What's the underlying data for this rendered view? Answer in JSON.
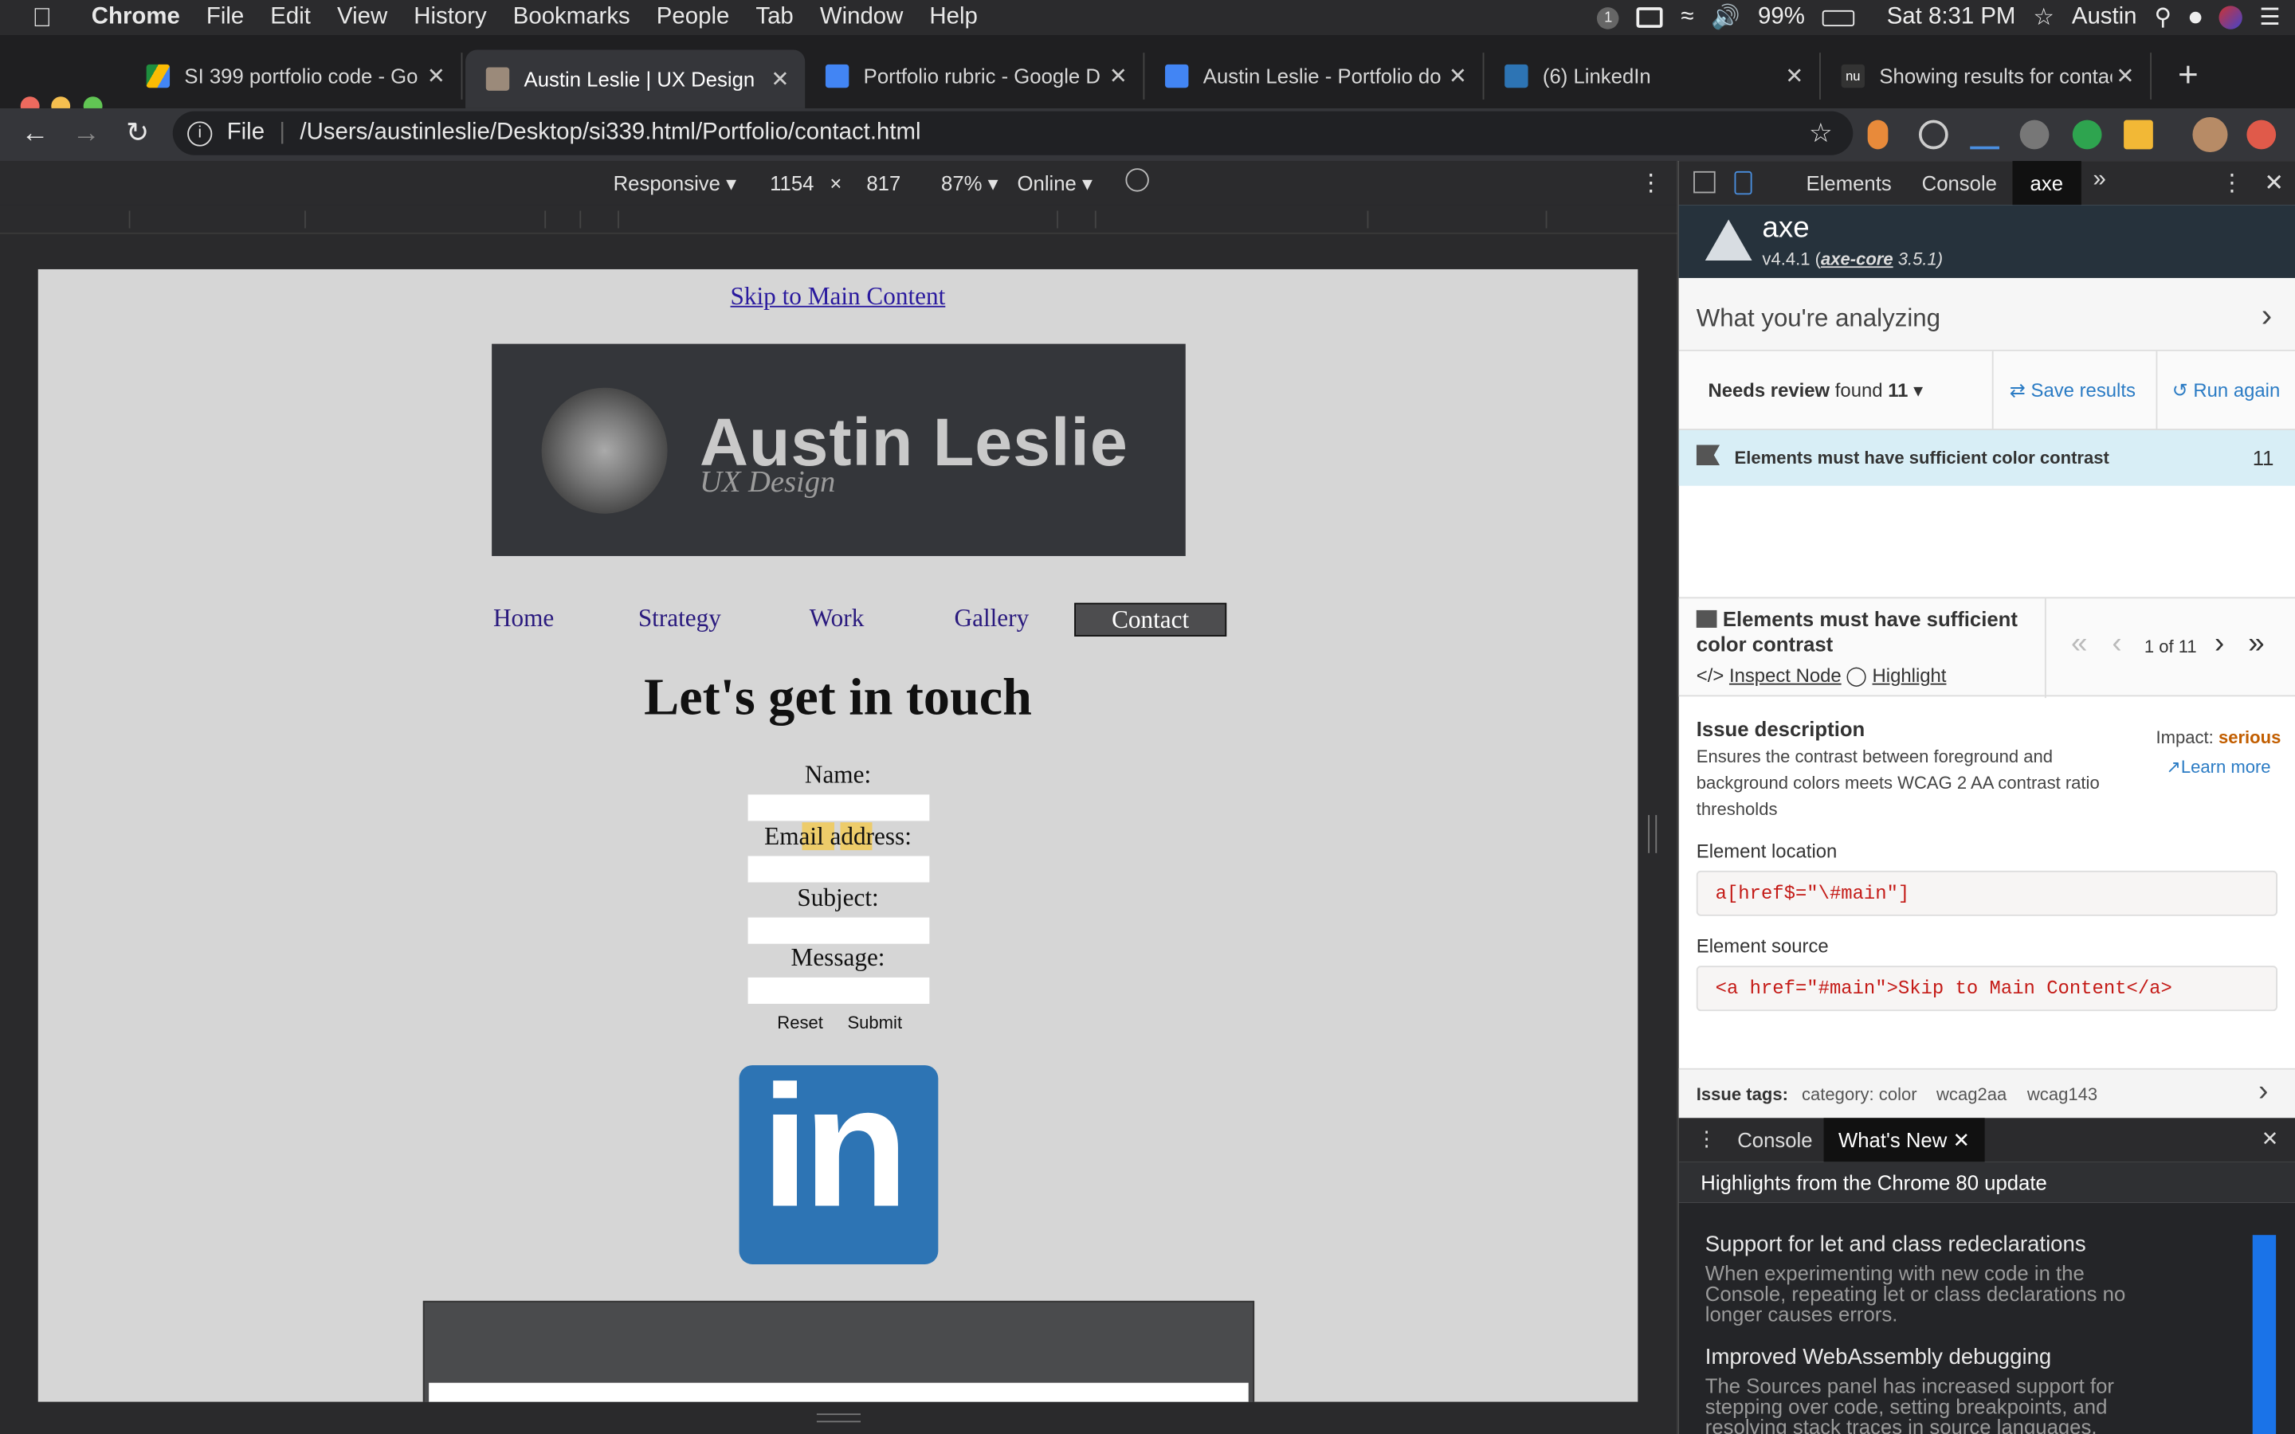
{
  "menubar": {
    "app": "Chrome",
    "items": [
      "File",
      "Edit",
      "View",
      "History",
      "Bookmarks",
      "People",
      "Tab",
      "Window",
      "Help"
    ],
    "battery": "99%",
    "clock": "Sat 8:31 PM",
    "user": "Austin",
    "notif_count": "1"
  },
  "tabs": [
    {
      "title": "SI 399 portfolio code - Go",
      "icon": "google-drive-icon"
    },
    {
      "title": "Austin Leslie | UX Design",
      "icon": "page-favicon"
    },
    {
      "title": "Portfolio rubric - Google D",
      "icon": "google-docs-icon"
    },
    {
      "title": "Austin Leslie - Portfolio do",
      "icon": "google-docs-icon"
    },
    {
      "title": "(6) LinkedIn",
      "icon": "linkedin-icon"
    },
    {
      "title": "Showing results for contac",
      "icon": "nu-icon"
    }
  ],
  "new_tab": "+",
  "address": {
    "scheme": "File",
    "url": "/Users/austinleslie/Desktop/si339.html/Portfolio/contact.html"
  },
  "device_toolbar": {
    "mode": "Responsive",
    "width": "1154",
    "times": "×",
    "height": "817",
    "zoom": "87%",
    "network": "Online"
  },
  "page": {
    "skip_link": "Skip to Main Content",
    "logo_name": "Austin Leslie",
    "logo_sub": "UX Design",
    "nav": [
      "Home",
      "Strategy",
      "Work",
      "Gallery",
      "Contact"
    ],
    "heading": "Let's get in touch",
    "fields": [
      "Name:",
      "Email address:",
      "Subject:",
      "Message:"
    ],
    "reset": "Reset",
    "submit": "Submit",
    "linkedin_text": "in"
  },
  "devtools": {
    "tabs": [
      "Elements",
      "Console",
      "axe"
    ],
    "axe_title": "axe",
    "axe_version_prefix": "v4.4.1 (",
    "axe_core_link": "axe-core",
    "axe_version_suffix": " 3.5.1)",
    "analyzing": "What you're analyzing",
    "needs_review": "Needs review",
    "found": "found",
    "count": "11",
    "save_results": "Save results",
    "run_again": "Run again",
    "issue_row_title": "Elements must have sufficient color contrast",
    "issue_row_count": "11",
    "detail_title": "Elements must have sufficient color contrast",
    "inspect_node": "Inspect Node",
    "highlight": "Highlight",
    "pager": "1 of 11",
    "issue_desc_title": "Issue description",
    "issue_desc": "Ensures the contrast between foreground and background colors meets WCAG 2 AA contrast ratio thresholds",
    "impact_label": "Impact:",
    "impact_value": "serious",
    "learn_more": "Learn more",
    "location_label": "Element location",
    "location_value": "a[href$=\"\\#main\"]",
    "source_label": "Element source",
    "source_value": "<a href=\"#main\">Skip to Main Content</a>",
    "tags_label": "Issue tags:",
    "tags": [
      "category: color",
      "wcag2aa",
      "wcag143"
    ]
  },
  "drawer": {
    "tabs": [
      "Console",
      "What's New"
    ],
    "highlights": "Highlights from the Chrome 80 update",
    "items": [
      {
        "title": "Support for let and class redeclarations",
        "body": "When experimenting with new code in the Console, repeating let or class declarations no longer causes errors."
      },
      {
        "title": "Improved WebAssembly debugging",
        "body": "The Sources panel has increased support for stepping over code, setting breakpoints, and resolving stack traces in source languages."
      }
    ]
  },
  "colors": {
    "accent": "#2a7bc4",
    "serious": "#c25e00",
    "linkedin": "#2d74b4"
  }
}
